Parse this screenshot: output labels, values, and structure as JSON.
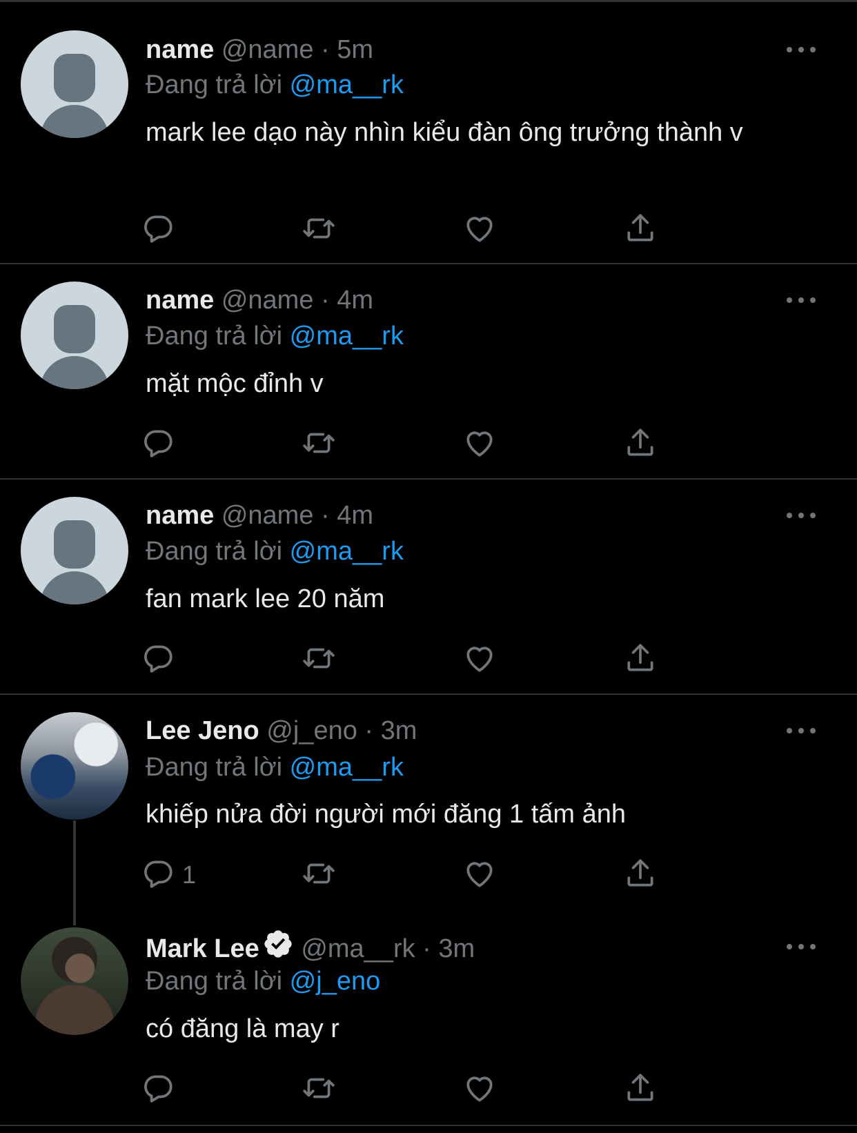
{
  "colors": {
    "background": "#000000",
    "text": "#e7e9ea",
    "muted": "#71767b",
    "accent": "#1d9bf0",
    "divider": "#2f3336"
  },
  "icons": {
    "reply": "reply-icon",
    "retweet": "retweet-icon",
    "like": "heart-icon",
    "share": "share-icon",
    "more": "more-icon",
    "verified": "verified-badge-icon"
  },
  "tweets": [
    {
      "display_name": "name",
      "handle": "@name",
      "dot": "·",
      "time": "5m",
      "reply_prefix": "Đang trả lời",
      "reply_to": "@ma__rk",
      "text": "mark lee dạo này nhìn kiểu đàn ông trưởng thành v",
      "reply_count": ""
    },
    {
      "display_name": "name",
      "handle": "@name",
      "dot": "·",
      "time": "4m",
      "reply_prefix": "Đang trả lời",
      "reply_to": "@ma__rk",
      "text": "mặt mộc đỉnh v",
      "reply_count": ""
    },
    {
      "display_name": "name",
      "handle": "@name",
      "dot": "·",
      "time": "4m",
      "reply_prefix": "Đang trả lời",
      "reply_to": "@ma__rk",
      "text": "fan mark lee 20 năm",
      "reply_count": ""
    },
    {
      "display_name": "Lee Jeno",
      "handle": "@j_eno",
      "dot": "·",
      "time": "3m",
      "reply_prefix": "Đang trả lời",
      "reply_to": "@ma__rk",
      "text": "khiếp nửa đời người mới đăng 1 tấm ảnh",
      "reply_count": "1"
    },
    {
      "display_name": "Mark Lee",
      "handle": "@ma__rk",
      "dot": "·",
      "time": "3m",
      "reply_prefix": "Đang trả lời",
      "reply_to": "@j_eno",
      "text": "có đăng là may r",
      "reply_count": "",
      "verified": true
    }
  ]
}
